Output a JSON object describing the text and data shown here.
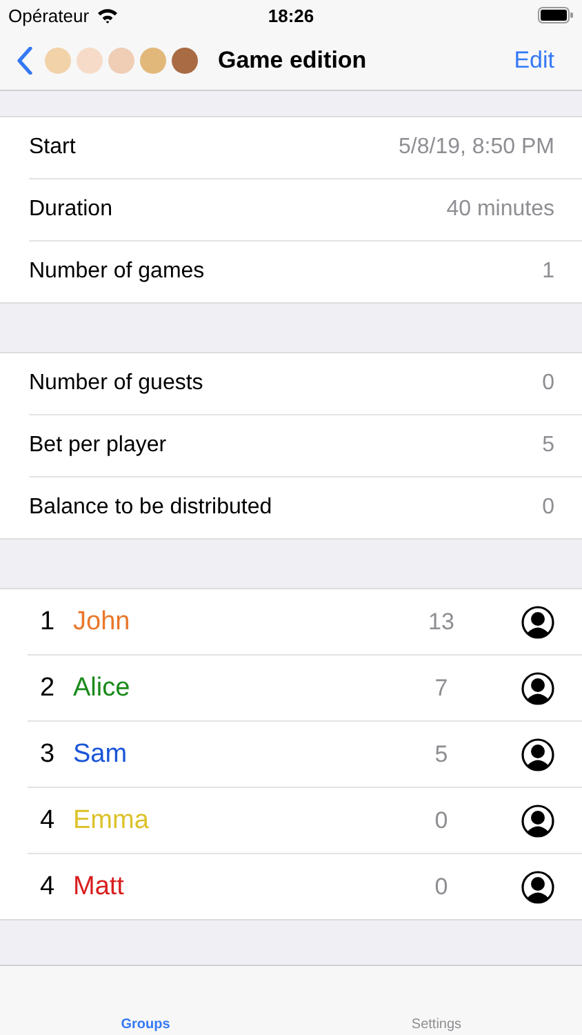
{
  "status_bar": {
    "carrier": "Opérateur",
    "time": "18:26"
  },
  "nav": {
    "avatars": [
      {
        "color": "#f2d2a8"
      },
      {
        "color": "#f6dcc8"
      },
      {
        "color": "#f0cdb5"
      },
      {
        "color": "#e2b87a"
      },
      {
        "color": "#a86b43"
      }
    ],
    "title": "Game edition",
    "action": "Edit"
  },
  "sections": [
    [
      {
        "label": "Start",
        "value": "5/8/19, 8:50 PM"
      },
      {
        "label": "Duration",
        "value": "40 minutes"
      },
      {
        "label": "Number of games",
        "value": "1"
      }
    ],
    [
      {
        "label": "Number of guests",
        "value": "0"
      },
      {
        "label": "Bet per player",
        "value": "5"
      },
      {
        "label": "Balance to be distributed",
        "value": "0"
      }
    ]
  ],
  "players": [
    {
      "rank": "1",
      "name": "John",
      "color": "#e8772a",
      "score": "13"
    },
    {
      "rank": "2",
      "name": "Alice",
      "color": "#1a8a1a",
      "score": "7"
    },
    {
      "rank": "3",
      "name": "Sam",
      "color": "#1a55d8",
      "score": "5"
    },
    {
      "rank": "4",
      "name": "Emma",
      "color": "#dcc22a",
      "score": "0"
    },
    {
      "rank": "4",
      "name": "Matt",
      "color": "#d81e1e",
      "score": "0"
    }
  ],
  "tab_bar": [
    {
      "label": "Groups",
      "selected": true
    },
    {
      "label": "Settings",
      "selected": false
    }
  ]
}
